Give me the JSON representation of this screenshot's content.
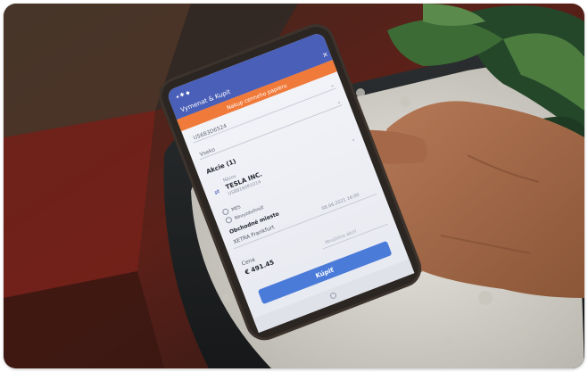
{
  "photo": {
    "description_alt": "",
    "colors": {
      "background_dark": "#2a2019",
      "background_red": "#6b1e1a",
      "pot": "#222527",
      "gravel": "#d9d7d0",
      "plant_green": "#2f5a2c",
      "hand_skin": "#a0694a",
      "phone_body": "#2c2622",
      "header_blue": "#4a5fb8",
      "banner_orange": "#f07a3a",
      "button_blue": "#4a7bd9"
    }
  },
  "phone_screen": {
    "status_bar": "◂ ✱ ◆",
    "title": "Vymenat & Kupit",
    "banner": "Nakup cenneho papieru",
    "field_account": "U5683D6524",
    "field_type": "Vseko",
    "section_title": "Akcie (1)",
    "security_label": "Názov",
    "security_name": "TESLA INC.",
    "security_sub": "US88160R1014",
    "currency_label": "MES",
    "option_label": "Nevyzdvihnúť",
    "market_label": "Obchodné miesto",
    "market_value": "XETRA Frankfurt",
    "date_value": "08.06.2021 16:00",
    "price_label": "Cena",
    "price_value": "€ 491.45",
    "quantity_placeholder": "Množstvo akcií",
    "buy_button": "Kúpiť"
  }
}
